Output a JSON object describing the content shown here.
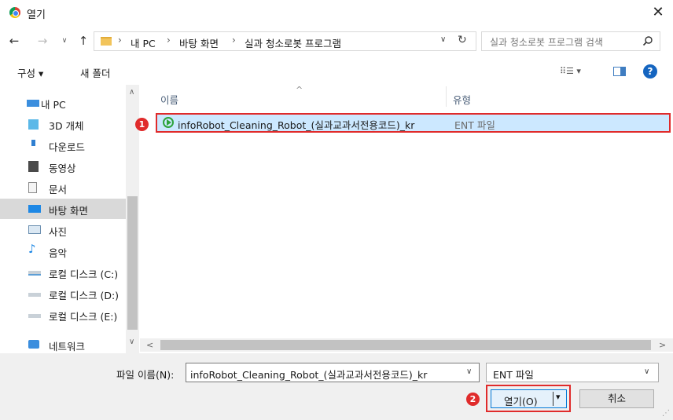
{
  "window": {
    "title": "열기",
    "close_glyph": "✕"
  },
  "nav": {
    "back": "←",
    "forward": "→",
    "recent": "∨",
    "up": "↑"
  },
  "address": {
    "crumbs": [
      "내 PC",
      "바탕 화면",
      "실과 청소로봇 프로그램"
    ],
    "separator": "›",
    "dropdown": "∨",
    "refresh": "↻"
  },
  "search": {
    "placeholder": "실과 청소로봇 프로그램 검색"
  },
  "toolbar": {
    "organize_label": "구성 ▾",
    "new_folder_label": "새 폴더",
    "view_label": "⠿☰ ▾",
    "help_label": "?"
  },
  "sidebar": {
    "items": [
      {
        "label": "내 PC"
      },
      {
        "label": "3D 개체"
      },
      {
        "label": "다운로드"
      },
      {
        "label": "동영상"
      },
      {
        "label": "문서"
      },
      {
        "label": "바탕 화면"
      },
      {
        "label": "사진"
      },
      {
        "label": "음악"
      },
      {
        "label": "로컬 디스크 (C:)"
      },
      {
        "label": "로컬 디스크 (D:)"
      },
      {
        "label": "로컬 디스크 (E:)"
      },
      {
        "label": "네트워크"
      }
    ],
    "scroll_up": "∧",
    "scroll_down": "∨"
  },
  "filelist": {
    "columns": {
      "name": "이름",
      "type": "유형",
      "sort_arrow": "^"
    },
    "files": [
      {
        "name": "infoRobot_Cleaning_Robot_(실과교과서전용코드)_kr",
        "type": "ENT 파일"
      }
    ],
    "scroll_left": "<",
    "scroll_right": ">"
  },
  "markers": {
    "one": "1",
    "two": "2"
  },
  "bottom": {
    "filename_label": "파일 이름(N):",
    "filename_value": "infoRobot_Cleaning_Robot_(실과교과서전용코드)_kr",
    "filename_drop": "∨",
    "filetype_value": "ENT 파일",
    "filetype_drop": "∨",
    "open_label": "열기(O)",
    "open_drop": "▾",
    "cancel_label": "취소",
    "grip": "⋰"
  },
  "colors": {
    "accent": "#0078d7",
    "selection": "#cce8ff",
    "highlight_red": "#e02b2b"
  }
}
